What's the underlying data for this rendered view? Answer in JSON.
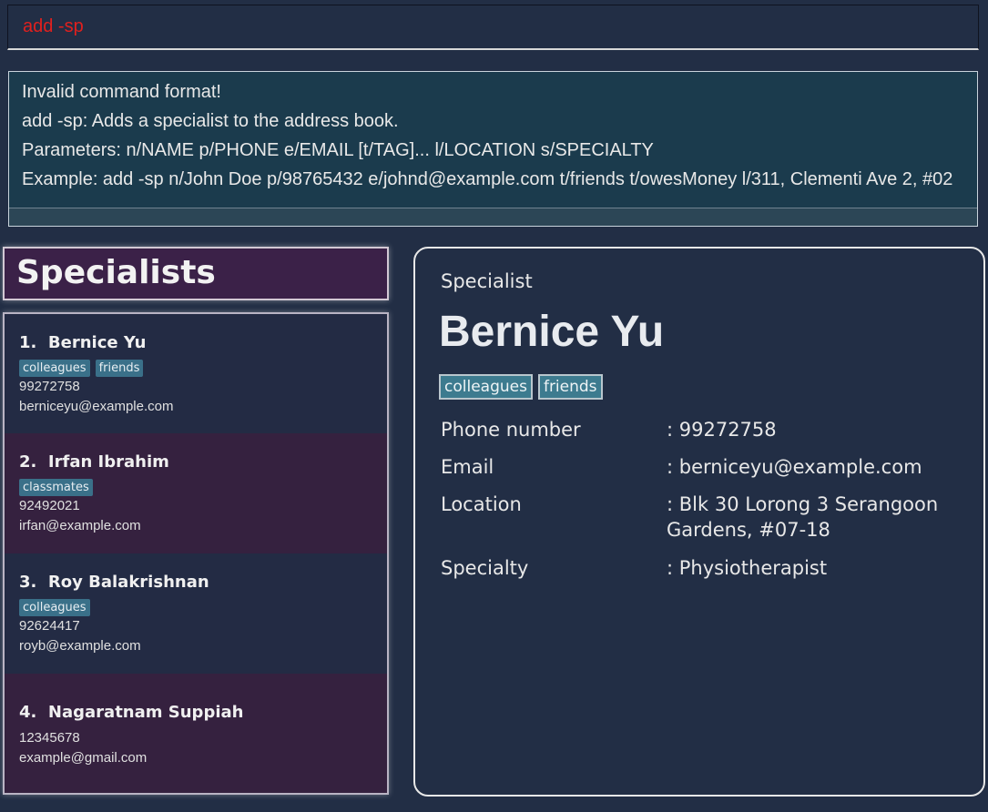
{
  "command": {
    "input": "add -sp"
  },
  "result": {
    "lines": [
      "Invalid command format!",
      "add -sp: Adds a specialist to the address book.",
      "Parameters: n/NAME p/PHONE e/EMAIL [t/TAG]... l/LOCATION s/SPECIALTY",
      "Example: add -sp n/John Doe p/98765432 e/johnd@example.com t/friends t/owesMoney l/311, Clementi Ave 2, #02"
    ]
  },
  "list": {
    "title": "Specialists",
    "items": [
      {
        "index": "1.",
        "name": "Bernice Yu",
        "tags": [
          "colleagues",
          "friends"
        ],
        "phone": "99272758",
        "email": "berniceyu@example.com"
      },
      {
        "index": "2.",
        "name": "Irfan Ibrahim",
        "tags": [
          "classmates"
        ],
        "phone": "92492021",
        "email": "irfan@example.com"
      },
      {
        "index": "3.",
        "name": "Roy Balakrishnan",
        "tags": [
          "colleagues"
        ],
        "phone": "92624417",
        "email": "royb@example.com"
      },
      {
        "index": "4.",
        "name": "Nagaratnam Suppiah",
        "tags": [],
        "phone": "12345678",
        "email": "example@gmail.com"
      }
    ]
  },
  "detail": {
    "heading": "Specialist",
    "name": "Bernice Yu",
    "tags": [
      "colleagues",
      "friends"
    ],
    "fields": [
      {
        "label": "Phone number",
        "value": ": 99272758"
      },
      {
        "label": "Email",
        "value": ": berniceyu@example.com"
      },
      {
        "label": "Location",
        "value": ": Blk 30 Lorong 3 Serangoon Gardens, #07-18"
      },
      {
        "label": "Specialty",
        "value": ": Physiotherapist"
      }
    ]
  },
  "colors": {
    "background": "#222e45",
    "command_text": "#e0201e",
    "result_background": "#1b3b4d",
    "title_background": "#3b2148",
    "card_even": "#232b44",
    "card_odd": "#35213f",
    "tag": "#3a7089"
  }
}
